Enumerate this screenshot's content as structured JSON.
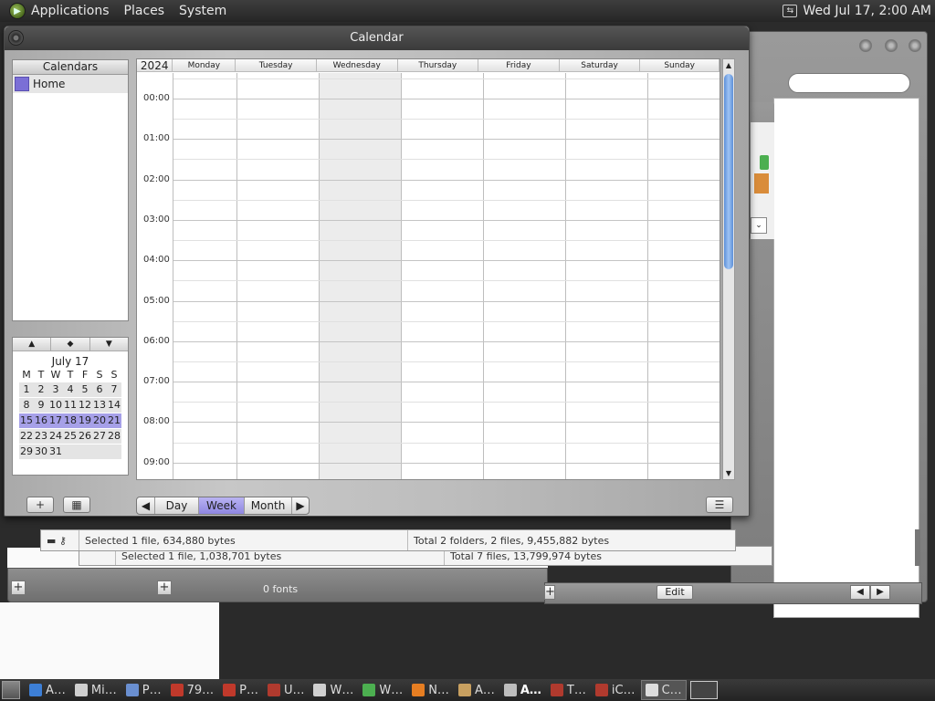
{
  "top_panel": {
    "menus": [
      "Applications",
      "Places",
      "System"
    ],
    "clock": "Wed Jul 17,  2:00 AM"
  },
  "calendar_window": {
    "title": "Calendar",
    "calendars_header": "Calendars",
    "calendars": [
      {
        "name": "Home",
        "color": "#7b6fd6"
      }
    ],
    "week_grid": {
      "year": "2024",
      "days": [
        "Monday",
        "Tuesday",
        "Wednesday",
        "Thursday",
        "Friday",
        "Saturday",
        "Sunday"
      ],
      "today_index": 2,
      "hours": [
        "00:00",
        "01:00",
        "02:00",
        "03:00",
        "04:00",
        "05:00",
        "06:00",
        "07:00",
        "08:00",
        "09:00"
      ]
    },
    "mini_calendar": {
      "title": "July 17",
      "nav": [
        "▲",
        "◆",
        "▼"
      ],
      "weekday_headers": [
        "M",
        "T",
        "W",
        "T",
        "F",
        "S",
        "S"
      ],
      "weeks": [
        [
          "1",
          "2",
          "3",
          "4",
          "5",
          "6",
          "7"
        ],
        [
          "8",
          "9",
          "10",
          "11",
          "12",
          "13",
          "14"
        ],
        [
          "15",
          "16",
          "17",
          "18",
          "19",
          "20",
          "21"
        ],
        [
          "22",
          "23",
          "24",
          "25",
          "26",
          "27",
          "28"
        ],
        [
          "29",
          "30",
          "31",
          "",
          "",
          "",
          ""
        ]
      ],
      "selected_week_index": 2
    },
    "view_switcher": {
      "prev": "◀",
      "next": "▶",
      "views": [
        "Day",
        "Week",
        "Month"
      ],
      "active": "Week"
    },
    "add_button": "+",
    "list_button": "☰",
    "grid_button": "▦"
  },
  "background_windows": {
    "status_top": [
      "Selected 1 file, 634,880 bytes",
      "Total 2 folders, 2 files, 9,455,882 bytes"
    ],
    "status_bottom": [
      "Selected 1 file, 1,038,701 bytes",
      "Total 7 files, 13,799,974 bytes"
    ],
    "fonts_label": "0 fonts",
    "edit_button": "Edit"
  },
  "taskbar": {
    "items": [
      {
        "label": "A…",
        "color": "#3d7fd6"
      },
      {
        "label": "Mi…",
        "color": "#cfcfcf"
      },
      {
        "label": "P…",
        "color": "#6a8fd0"
      },
      {
        "label": "79…",
        "color": "#c0392b"
      },
      {
        "label": "P…",
        "color": "#c0392b"
      },
      {
        "label": "U…",
        "color": "#b03a2e"
      },
      {
        "label": "W…",
        "color": "#d0d0d0"
      },
      {
        "label": "W…",
        "color": "#4caf50"
      },
      {
        "label": "N…",
        "color": "#e67e22"
      },
      {
        "label": "A…",
        "color": "#c8a060"
      },
      {
        "label": "A…",
        "color": "#bdbdbd",
        "bold": true
      },
      {
        "label": "T…",
        "color": "#b03a2e"
      },
      {
        "label": "iC…",
        "color": "#b03a2e"
      },
      {
        "label": "C…",
        "color": "#dddddd",
        "active": true
      }
    ]
  }
}
